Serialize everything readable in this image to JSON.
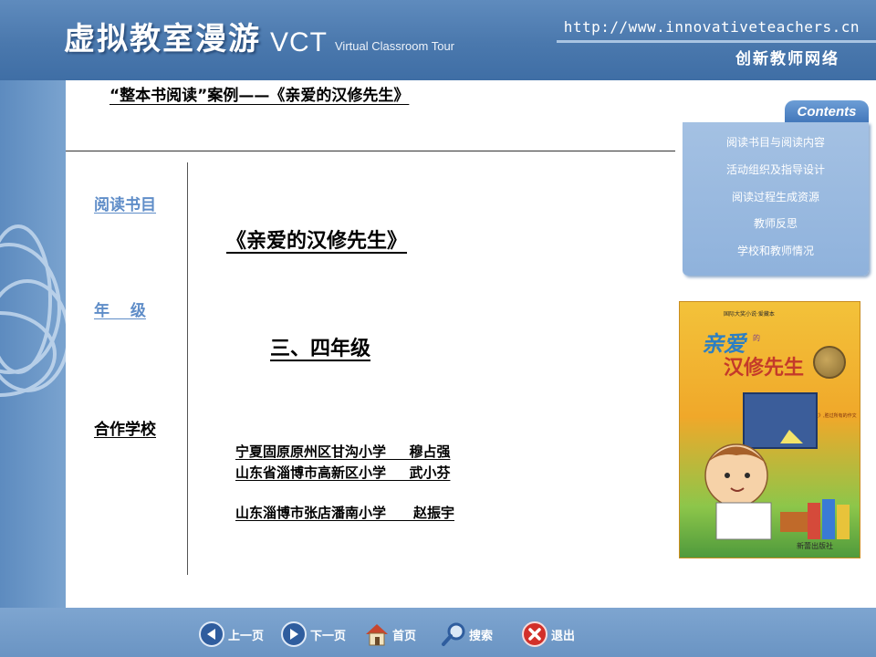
{
  "header": {
    "logo_cn": "虚拟教室漫游",
    "logo_abbr": "VCT",
    "logo_en": "Virtual Classroom Tour",
    "url": "http://www.innovativeteachers.cn",
    "site_name": "创新教师网络"
  },
  "main": {
    "title": "“整本书阅读”案例——《亲爱的汉修先生》",
    "labels": {
      "book": "阅读书目",
      "grade": "年　 级",
      "schools": "合作学校"
    },
    "book_title": "《亲爱的汉修先生》",
    "grade_value": "三、四年级",
    "schools": [
      "宁夏固原原州区甘沟小学　  穆占强",
      "山东省淄博市高新区小学　  武小芬",
      "山东淄博市张店潘南小学　　赵振宇"
    ]
  },
  "contents": {
    "tab_label": "Contents",
    "items": [
      "阅读书目与阅读内容",
      "活动组织及指导设计",
      "阅读过程生成资源",
      "教师反思",
      "学校和教师情况"
    ]
  },
  "cover": {
    "series": "国际大奖小说·爱藏本",
    "title_line1": "亲爱",
    "title_de": "的",
    "title_line2": "汉修先生",
    "blurb": "一本《亲爱的汉修先生》,胜过所有的作文书!",
    "publisher": "新蕾出版社"
  },
  "footer": {
    "prev": "上一页",
    "next": "下一页",
    "home": "首页",
    "search": "搜索",
    "exit": "退出"
  },
  "colors": {
    "frame_blue": "#6f98c4",
    "header_blue": "#4a78ad",
    "link_blue": "#5f8dc8",
    "menu_blue": "#9dbbe0",
    "exit_red": "#d2302a"
  }
}
